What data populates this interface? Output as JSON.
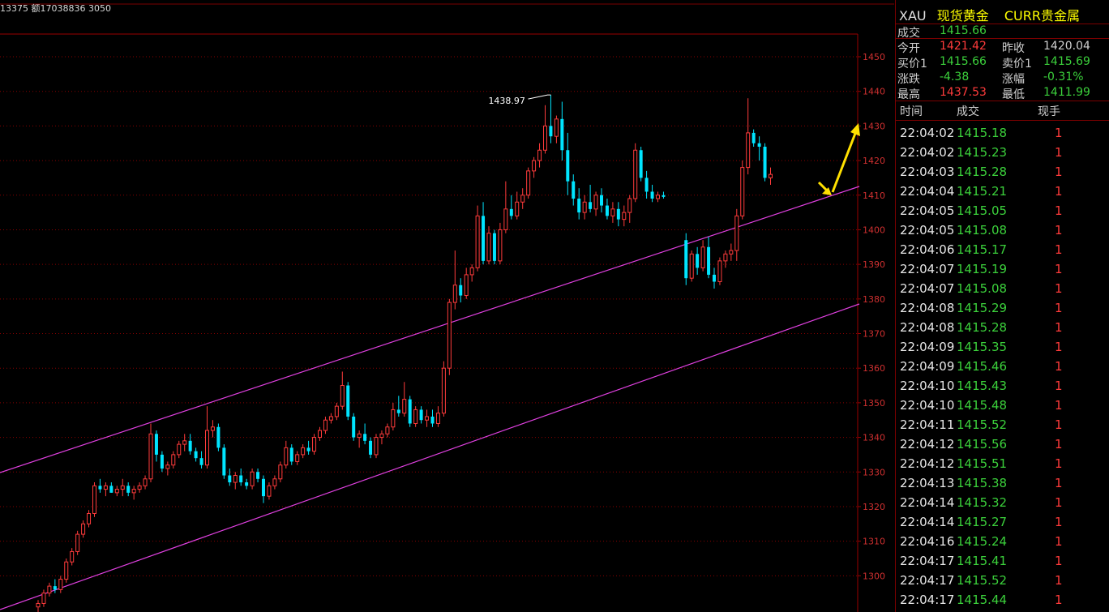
{
  "header_line": "13375 额17038836 3050",
  "quote": {
    "code": "XAU",
    "name": "现货黄金",
    "market": "CURR贵金属",
    "last_label": "成交",
    "last": "1415.66",
    "open_label": "今开",
    "open": "1421.42",
    "prev_close_label": "昨收",
    "prev_close": "1420.04",
    "bid_label": "买价1",
    "bid": "1415.66",
    "ask_label": "卖价1",
    "ask": "1415.69",
    "change_label": "涨跌",
    "change": "-4.38",
    "change_pct_label": "涨幅",
    "change_pct": "-0.31%",
    "high_label": "最高",
    "high": "1437.53",
    "low_label": "最低",
    "low": "1411.99"
  },
  "ticks_header": {
    "time": "时间",
    "price": "成交",
    "volume": "现手"
  },
  "ticks": [
    {
      "time": "22:04:02",
      "price": "1415.18",
      "volume": "1"
    },
    {
      "time": "22:04:02",
      "price": "1415.23",
      "volume": "1"
    },
    {
      "time": "22:04:03",
      "price": "1415.28",
      "volume": "1"
    },
    {
      "time": "22:04:04",
      "price": "1415.21",
      "volume": "1"
    },
    {
      "time": "22:04:05",
      "price": "1415.05",
      "volume": "1"
    },
    {
      "time": "22:04:05",
      "price": "1415.08",
      "volume": "1"
    },
    {
      "time": "22:04:06",
      "price": "1415.17",
      "volume": "1"
    },
    {
      "time": "22:04:07",
      "price": "1415.19",
      "volume": "1"
    },
    {
      "time": "22:04:07",
      "price": "1415.08",
      "volume": "1"
    },
    {
      "time": "22:04:08",
      "price": "1415.29",
      "volume": "1"
    },
    {
      "time": "22:04:08",
      "price": "1415.28",
      "volume": "1"
    },
    {
      "time": "22:04:09",
      "price": "1415.35",
      "volume": "1"
    },
    {
      "time": "22:04:09",
      "price": "1415.46",
      "volume": "1"
    },
    {
      "time": "22:04:10",
      "price": "1415.43",
      "volume": "1"
    },
    {
      "time": "22:04:10",
      "price": "1415.48",
      "volume": "1"
    },
    {
      "time": "22:04:11",
      "price": "1415.52",
      "volume": "1"
    },
    {
      "time": "22:04:12",
      "price": "1415.56",
      "volume": "1"
    },
    {
      "time": "22:04:12",
      "price": "1415.51",
      "volume": "1"
    },
    {
      "time": "22:04:13",
      "price": "1415.38",
      "volume": "1"
    },
    {
      "time": "22:04:14",
      "price": "1415.32",
      "volume": "1"
    },
    {
      "time": "22:04:14",
      "price": "1415.27",
      "volume": "1"
    },
    {
      "time": "22:04:16",
      "price": "1415.24",
      "volume": "1"
    },
    {
      "time": "22:04:17",
      "price": "1415.41",
      "volume": "1"
    },
    {
      "time": "22:04:17",
      "price": "1415.52",
      "volume": "1"
    },
    {
      "time": "22:04:17",
      "price": "1415.44",
      "volume": "1"
    }
  ],
  "chart_data": {
    "type": "candlestick",
    "title": "",
    "y_ticks": [
      1300,
      1310,
      1320,
      1330,
      1340,
      1350,
      1360,
      1370,
      1380,
      1390,
      1400,
      1410,
      1420,
      1430,
      1440,
      1450
    ],
    "y_tick_labels": [
      "1300",
      "1310",
      "1320",
      "1330",
      "1340",
      "1350",
      "1360",
      "1370",
      "1380",
      "1390",
      "1400",
      "1410",
      "1420",
      "1430",
      "1440",
      "1450"
    ],
    "ylim": [
      1290,
      1456
    ],
    "peak_annotation": {
      "label": "1438.97",
      "value": 1438.97
    },
    "up_color": "#ff3b3b",
    "down_color": "#00e5ff",
    "channel_color": "#e040e0",
    "arrow_color": "#ffe000",
    "candles": [
      [
        1291,
        1293,
        1289,
        1292
      ],
      [
        1292,
        1296,
        1291,
        1295
      ],
      [
        1295,
        1298,
        1294,
        1297
      ],
      [
        1297,
        1299,
        1295,
        1296
      ],
      [
        1296,
        1300,
        1295,
        1299
      ],
      [
        1299,
        1305,
        1298,
        1304
      ],
      [
        1304,
        1308,
        1303,
        1307
      ],
      [
        1307,
        1313,
        1306,
        1312
      ],
      [
        1312,
        1316,
        1311,
        1315
      ],
      [
        1315,
        1319,
        1314,
        1318
      ],
      [
        1318,
        1327,
        1317,
        1326
      ],
      [
        1326,
        1328,
        1324,
        1325
      ],
      [
        1325,
        1327,
        1323,
        1326
      ],
      [
        1326,
        1327,
        1324,
        1324
      ],
      [
        1324,
        1326,
        1323,
        1325
      ],
      [
        1325,
        1328,
        1323,
        1326
      ],
      [
        1326,
        1327,
        1323,
        1324
      ],
      [
        1324,
        1326,
        1322,
        1325
      ],
      [
        1325,
        1327,
        1324,
        1326
      ],
      [
        1326,
        1329,
        1325,
        1328
      ],
      [
        1328,
        1344,
        1327,
        1341
      ],
      [
        1341,
        1342,
        1333,
        1335
      ],
      [
        1335,
        1336,
        1330,
        1331
      ],
      [
        1331,
        1333,
        1329,
        1332
      ],
      [
        1332,
        1336,
        1331,
        1335
      ],
      [
        1335,
        1339,
        1334,
        1338
      ],
      [
        1338,
        1341,
        1336,
        1339
      ],
      [
        1339,
        1341,
        1335,
        1336
      ],
      [
        1336,
        1337,
        1333,
        1334
      ],
      [
        1334,
        1336,
        1331,
        1332
      ],
      [
        1332,
        1349,
        1331,
        1342
      ],
      [
        1342,
        1345,
        1340,
        1343
      ],
      [
        1343,
        1344,
        1336,
        1337
      ],
      [
        1337,
        1338,
        1328,
        1329
      ],
      [
        1329,
        1331,
        1326,
        1327
      ],
      [
        1327,
        1330,
        1325,
        1329
      ],
      [
        1329,
        1331,
        1326,
        1327
      ],
      [
        1327,
        1328,
        1325,
        1326
      ],
      [
        1326,
        1331,
        1325,
        1330
      ],
      [
        1330,
        1331,
        1327,
        1328
      ],
      [
        1328,
        1329,
        1321,
        1323
      ],
      [
        1323,
        1327,
        1322,
        1326
      ],
      [
        1326,
        1329,
        1325,
        1328
      ],
      [
        1328,
        1333,
        1327,
        1332
      ],
      [
        1332,
        1339,
        1331,
        1337
      ],
      [
        1337,
        1338,
        1332,
        1333
      ],
      [
        1333,
        1336,
        1332,
        1335
      ],
      [
        1335,
        1338,
        1334,
        1337
      ],
      [
        1337,
        1339,
        1335,
        1336
      ],
      [
        1336,
        1341,
        1335,
        1340
      ],
      [
        1340,
        1343,
        1339,
        1342
      ],
      [
        1342,
        1346,
        1341,
        1345
      ],
      [
        1345,
        1347,
        1344,
        1346
      ],
      [
        1346,
        1350,
        1345,
        1349
      ],
      [
        1349,
        1359,
        1348,
        1355
      ],
      [
        1355,
        1356,
        1345,
        1346
      ],
      [
        1346,
        1347,
        1339,
        1340
      ],
      [
        1340,
        1342,
        1337,
        1341
      ],
      [
        1341,
        1344,
        1338,
        1339
      ],
      [
        1339,
        1340,
        1334,
        1335
      ],
      [
        1335,
        1341,
        1334,
        1340
      ],
      [
        1340,
        1342,
        1338,
        1341
      ],
      [
        1341,
        1344,
        1340,
        1343
      ],
      [
        1343,
        1350,
        1342,
        1348
      ],
      [
        1348,
        1352,
        1346,
        1347
      ],
      [
        1347,
        1356,
        1346,
        1351
      ],
      [
        1351,
        1352,
        1343,
        1344
      ],
      [
        1344,
        1349,
        1343,
        1348
      ],
      [
        1348,
        1349,
        1344,
        1345
      ],
      [
        1345,
        1348,
        1343,
        1346
      ],
      [
        1346,
        1348,
        1343,
        1344
      ],
      [
        1344,
        1349,
        1343,
        1347
      ],
      [
        1347,
        1362,
        1346,
        1360
      ],
      [
        1360,
        1380,
        1358,
        1379
      ],
      [
        1379,
        1394,
        1377,
        1384
      ],
      [
        1384,
        1386,
        1379,
        1381
      ],
      [
        1381,
        1389,
        1380,
        1387
      ],
      [
        1387,
        1390,
        1385,
        1389
      ],
      [
        1389,
        1407,
        1388,
        1404
      ],
      [
        1404,
        1408,
        1390,
        1391
      ],
      [
        1391,
        1401,
        1390,
        1399
      ],
      [
        1399,
        1400,
        1390,
        1391
      ],
      [
        1391,
        1402,
        1390,
        1400
      ],
      [
        1400,
        1414,
        1399,
        1406
      ],
      [
        1406,
        1410,
        1403,
        1404
      ],
      [
        1404,
        1411,
        1403,
        1408
      ],
      [
        1408,
        1412,
        1406,
        1410
      ],
      [
        1410,
        1418,
        1409,
        1417
      ],
      [
        1417,
        1421,
        1415,
        1420
      ],
      [
        1420,
        1425,
        1418,
        1423
      ],
      [
        1423,
        1436,
        1422,
        1430
      ],
      [
        1430,
        1439,
        1425,
        1427
      ],
      [
        1427,
        1433,
        1425,
        1432
      ],
      [
        1432,
        1437,
        1420,
        1423
      ],
      [
        1423,
        1428,
        1410,
        1414
      ],
      [
        1414,
        1416,
        1407,
        1409
      ],
      [
        1409,
        1412,
        1403,
        1405
      ],
      [
        1405,
        1410,
        1403,
        1408
      ],
      [
        1408,
        1413,
        1405,
        1406
      ],
      [
        1406,
        1411,
        1404,
        1410
      ],
      [
        1410,
        1412,
        1405,
        1407
      ],
      [
        1407,
        1409,
        1403,
        1404
      ],
      [
        1404,
        1408,
        1402,
        1406
      ],
      [
        1406,
        1408,
        1401,
        1403
      ],
      [
        1403,
        1407,
        1401,
        1405
      ],
      [
        1405,
        1410,
        1402,
        1409
      ],
      [
        1409,
        1425,
        1408,
        1423
      ],
      [
        1423,
        1424,
        1414,
        1415
      ],
      [
        1415,
        1417,
        1409,
        1411
      ],
      [
        1411,
        1413,
        1408,
        1409
      ],
      [
        1409,
        1411,
        1408,
        1410
      ],
      [
        1410,
        1411,
        1409,
        1409.5
      ],
      null,
      null,
      null,
      [
        1397,
        1399,
        1384,
        1386
      ],
      [
        1386,
        1394,
        1385,
        1393
      ],
      [
        1393,
        1395,
        1387,
        1389
      ],
      [
        1389,
        1397,
        1388,
        1395
      ],
      [
        1395,
        1398,
        1386,
        1387
      ],
      [
        1387,
        1389,
        1383,
        1385
      ],
      [
        1385,
        1392,
        1384,
        1391
      ],
      [
        1391,
        1394,
        1389,
        1393
      ],
      [
        1393,
        1396,
        1391,
        1394
      ],
      [
        1394,
        1406,
        1391,
        1404
      ],
      [
        1404,
        1420,
        1403,
        1418
      ],
      [
        1418,
        1438,
        1416,
        1428
      ],
      [
        1428,
        1429,
        1424,
        1425
      ],
      [
        1425,
        1427,
        1420,
        1424
      ],
      [
        1424,
        1425,
        1414,
        1415
      ],
      [
        1415,
        1418,
        1413,
        1416
      ]
    ]
  }
}
